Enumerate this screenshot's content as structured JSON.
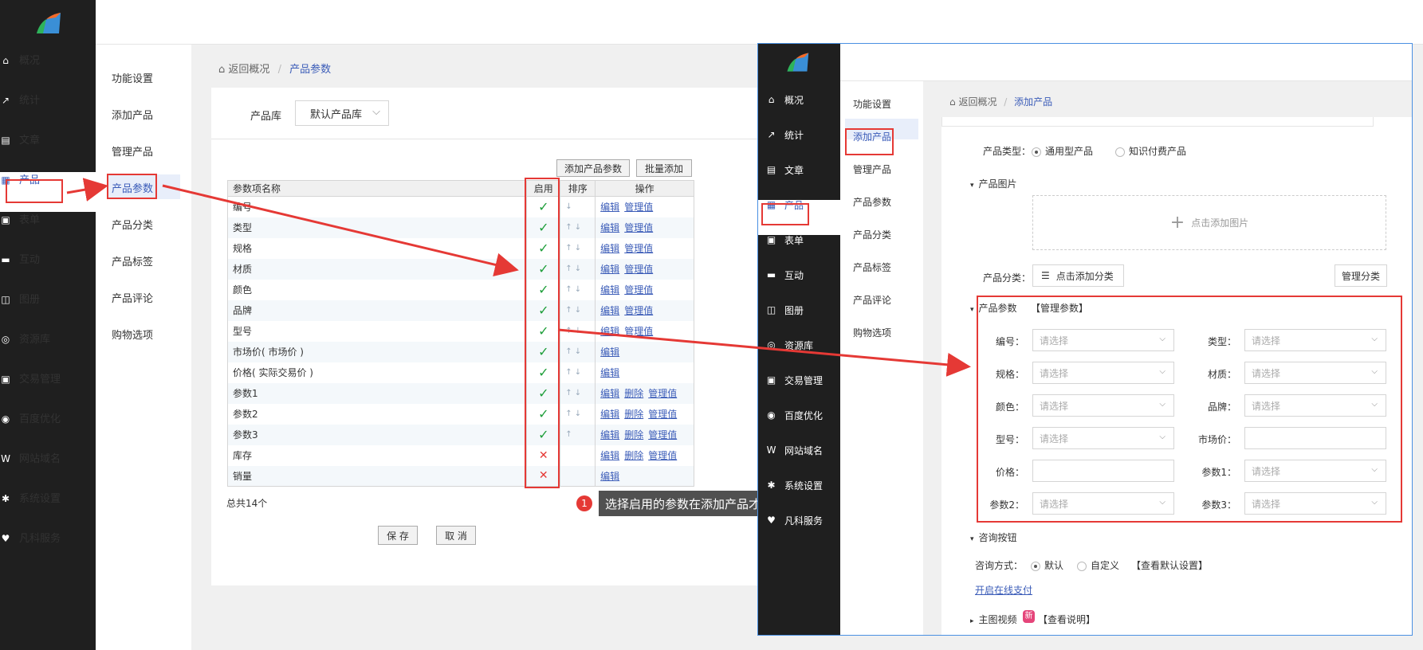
{
  "main_nav": [
    {
      "label": "概况",
      "icon": "home-icon",
      "glyph": "⌂"
    },
    {
      "label": "统计",
      "icon": "chart-icon",
      "glyph": "↗"
    },
    {
      "label": "文章",
      "icon": "doc-icon",
      "glyph": "▤"
    },
    {
      "label": "产品",
      "icon": "grid-icon",
      "glyph": "▦"
    },
    {
      "label": "表单",
      "icon": "form-icon",
      "glyph": "▣"
    },
    {
      "label": "互动",
      "icon": "chat-icon",
      "glyph": "▬"
    },
    {
      "label": "图册",
      "icon": "image-icon",
      "glyph": "◫"
    },
    {
      "label": "资源库",
      "icon": "database-icon",
      "glyph": "◎"
    },
    {
      "label": "交易管理",
      "icon": "clipboard-icon",
      "glyph": "▣"
    },
    {
      "label": "百度优化",
      "icon": "seo-icon",
      "glyph": "◉"
    },
    {
      "label": "网站域名",
      "icon": "w-icon",
      "glyph": "W"
    },
    {
      "label": "系统设置",
      "icon": "gear-icon",
      "glyph": "✱"
    },
    {
      "label": "凡科服务",
      "icon": "heart-icon",
      "glyph": "♥"
    }
  ],
  "sub_nav": [
    "功能设置",
    "添加产品",
    "管理产品",
    "产品参数",
    "产品分类",
    "产品标签",
    "产品评论",
    "购物选项"
  ],
  "breadcrumb": {
    "back": "返回概况",
    "sep": "/",
    "current": "产品参数"
  },
  "library": {
    "label": "产品库",
    "value": "默认产品库"
  },
  "buttons": {
    "add_param": "添加产品参数",
    "batch_add": "批量添加",
    "save": "保 存",
    "cancel": "取 消"
  },
  "table": {
    "headers": [
      "参数项名称",
      "启用",
      "排序",
      "操作"
    ],
    "rows": [
      {
        "name": "编号",
        "enabled": "✓",
        "sort": "↓",
        "ops": [
          "编辑",
          "管理值"
        ]
      },
      {
        "name": "类型",
        "enabled": "✓",
        "sort": "↑ ↓",
        "ops": [
          "编辑",
          "管理值"
        ]
      },
      {
        "name": "规格",
        "enabled": "✓",
        "sort": "↑ ↓",
        "ops": [
          "编辑",
          "管理值"
        ]
      },
      {
        "name": "材质",
        "enabled": "✓",
        "sort": "↑ ↓",
        "ops": [
          "编辑",
          "管理值"
        ]
      },
      {
        "name": "颜色",
        "enabled": "✓",
        "sort": "↑ ↓",
        "ops": [
          "编辑",
          "管理值"
        ]
      },
      {
        "name": "品牌",
        "enabled": "✓",
        "sort": "↑ ↓",
        "ops": [
          "编辑",
          "管理值"
        ]
      },
      {
        "name": "型号",
        "enabled": "✓",
        "sort": "↑ ↓",
        "ops": [
          "编辑",
          "管理值"
        ]
      },
      {
        "name": "市场价( 市场价 )",
        "enabled": "✓",
        "sort": "↑ ↓",
        "ops": [
          "编辑"
        ]
      },
      {
        "name": "价格( 实际交易价 )",
        "enabled": "✓",
        "sort": "↑ ↓",
        "ops": [
          "编辑"
        ]
      },
      {
        "name": "参数1",
        "enabled": "✓",
        "sort": "↑ ↓",
        "ops": [
          "编辑",
          "删除",
          "管理值"
        ]
      },
      {
        "name": "参数2",
        "enabled": "✓",
        "sort": "↑ ↓",
        "ops": [
          "编辑",
          "删除",
          "管理值"
        ]
      },
      {
        "name": "参数3",
        "enabled": "✓",
        "sort": "↑",
        "ops": [
          "编辑",
          "删除",
          "管理值"
        ]
      },
      {
        "name": "库存",
        "enabled": "✕",
        "sort": "",
        "ops": [
          "编辑",
          "删除",
          "管理值"
        ]
      },
      {
        "name": "销量",
        "enabled": "✕",
        "sort": "",
        "ops": [
          "编辑"
        ]
      }
    ],
    "total": "总共14个"
  },
  "tip": {
    "num": "1",
    "text": "选择启用的参数在添加产品才会显示，不启用参数不做显示"
  },
  "shot": {
    "nav": [
      "概况",
      "统计",
      "文章",
      "产品",
      "表单",
      "互动",
      "图册",
      "资源库",
      "交易管理",
      "百度优化",
      "网站域名",
      "系统设置",
      "凡科服务"
    ],
    "sub": [
      "功能设置",
      "添加产品",
      "管理产品",
      "产品参数",
      "产品分类",
      "产品标签",
      "产品评论",
      "购物选项"
    ],
    "breadcrumb": {
      "back": "返回概况",
      "sep": "/",
      "current": "添加产品"
    },
    "type_label": "产品类型：",
    "type_opt1": "通用型产品",
    "type_opt2": "知识付费产品",
    "image_section": "产品图片",
    "add_image": "点击添加图片",
    "category_label": "产品分类：",
    "add_category": "点击添加分类",
    "manage_category": "管理分类",
    "param_section": "产品参数",
    "manage_params": "【管理参数】",
    "fields": [
      {
        "label": "编号：",
        "value": "请选择"
      },
      {
        "label": "类型：",
        "value": "请选择"
      },
      {
        "label": "规格：",
        "value": "请选择"
      },
      {
        "label": "材质：",
        "value": "请选择"
      },
      {
        "label": "颜色：",
        "value": "请选择"
      },
      {
        "label": "品牌：",
        "value": "请选择"
      },
      {
        "label": "型号：",
        "value": "请选择"
      },
      {
        "label": "市场价：",
        "value": ""
      },
      {
        "label": "价格：",
        "value": ""
      },
      {
        "label": "参数1：",
        "value": "请选择"
      },
      {
        "label": "参数2：",
        "value": "请选择"
      },
      {
        "label": "参数3：",
        "value": "请选择"
      }
    ],
    "consult_section": "咨询按钮",
    "consult_label": "咨询方式：",
    "consult_opt1": "默认",
    "consult_opt2": "自定义",
    "consult_view": "【查看默认设置】",
    "online_pay": "开启在线支付",
    "video_section": "主图视频",
    "video_badge": "新",
    "video_view": "【查看说明】"
  }
}
